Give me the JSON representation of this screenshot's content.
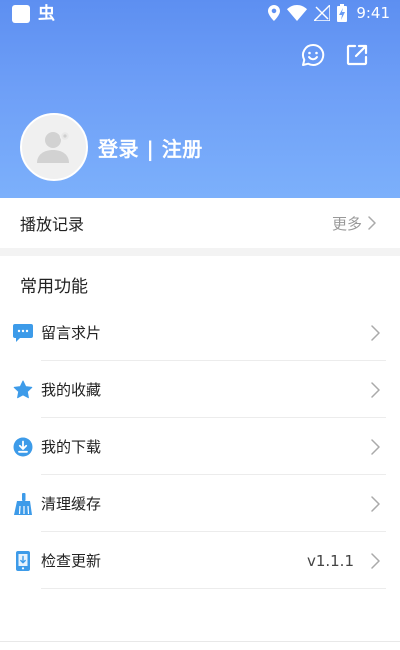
{
  "status_bar": {
    "app_glyph": "虫",
    "time": "9:41"
  },
  "header": {
    "feedback_icon": "chat-face-icon",
    "share_icon": "external-link-icon"
  },
  "profile": {
    "login_label": "登录 | 注册"
  },
  "history": {
    "title": "播放记录",
    "more_label": "更多"
  },
  "common": {
    "title": "常用功能",
    "items": [
      {
        "label": "留言求片",
        "icon": "message-icon",
        "value": ""
      },
      {
        "label": "我的收藏",
        "icon": "star-icon",
        "value": ""
      },
      {
        "label": "我的下载",
        "icon": "download-icon",
        "value": ""
      },
      {
        "label": "清理缓存",
        "icon": "broom-icon",
        "value": ""
      },
      {
        "label": "检查更新",
        "icon": "update-icon",
        "value": "v1.1.1"
      }
    ]
  },
  "colors": {
    "accent": "#3d9be9",
    "header_top": "#5d8ff1",
    "header_bottom": "#7cb0fb"
  }
}
